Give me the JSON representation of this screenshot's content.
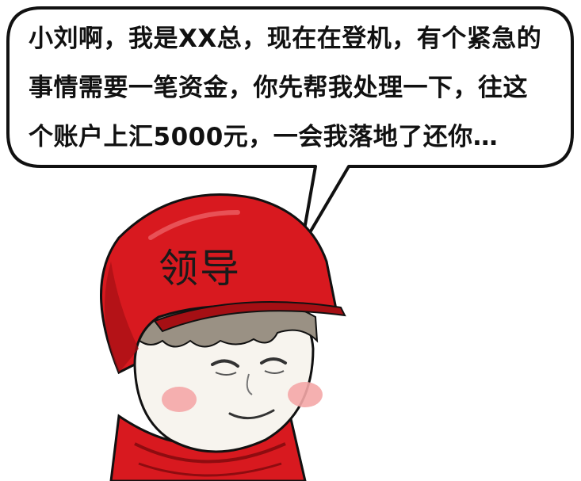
{
  "speech_bubble": {
    "lines": [
      "小刘啊，我是XX总，现在在登机，有个紧急的",
      "事情需要一笔资金，你先帮我处理一下，往这",
      "个账户上汇5000元，一会我落地了还你…"
    ]
  },
  "character": {
    "helmet_label": "领导"
  },
  "colors": {
    "helmet_red": "#d8191f",
    "helmet_dark": "#a50f14",
    "skin": "#f7f4ee",
    "blush": "#f4a7a7",
    "hair": "#9a9184",
    "outline": "#111111"
  }
}
